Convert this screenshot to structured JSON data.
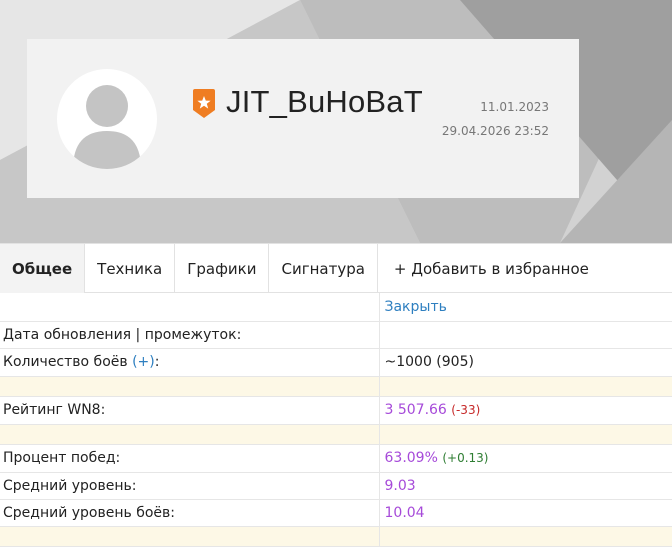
{
  "profile": {
    "nickname": "JIT_BuHoBaT",
    "date_primary": "11.01.2023",
    "date_secondary": "29.04.2026 23:52"
  },
  "tabs": [
    {
      "label": "Общее",
      "active": true
    },
    {
      "label": "Техника"
    },
    {
      "label": "Графики"
    },
    {
      "label": "Сигнатура"
    },
    {
      "label": "+ Добавить в избранное"
    }
  ],
  "stats": {
    "close_label": "Закрыть",
    "update_label": "Дата обновления | промежуток:",
    "battles_label": "Количество боёв",
    "battles_plus": "(+)",
    "battles_colon": ":",
    "battles_value": "~1000 (905)",
    "wn8_label": "Рейтинг WN8:",
    "wn8_value": "3 507.66",
    "wn8_delta": "(-33)",
    "winrate_label": "Процент побед:",
    "winrate_value": "63.09%",
    "winrate_delta": "(+0.13)",
    "avg_tier_label": "Средний уровень:",
    "avg_tier_value": "9.03",
    "avg_battle_tier_label": "Средний уровень боёв:",
    "avg_battle_tier_value": "10.04"
  },
  "colors": {
    "value_purple": "#a64ad9",
    "link_blue": "#2e7fc0",
    "delta_negative": "#c62828",
    "delta_positive": "#2e7d32",
    "badge_orange": "#ef7d22",
    "highlight_row": "#fdf8e6"
  }
}
